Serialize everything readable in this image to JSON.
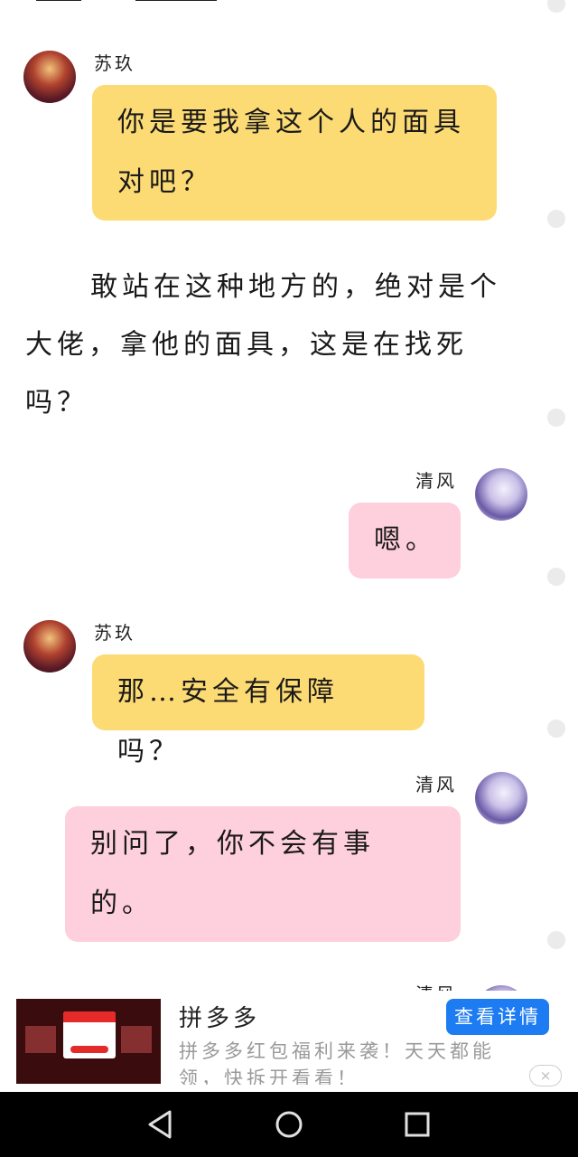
{
  "colors": {
    "yellow_bubble": "#fddb74",
    "pink_bubble": "#fecfdc",
    "ad_button": "#1d7cf2",
    "nav_bar": "#000000"
  },
  "chat": {
    "messages": [
      {
        "sender": "苏玖",
        "side": "left",
        "color": "yellow",
        "lines": [
          "你是要我拿这个人的面具",
          "对吧？"
        ]
      },
      {
        "type": "narration",
        "text": "敢站在这种地方的，绝对是个大佬，拿他的面具，这是在找死吗？"
      },
      {
        "sender": "清风",
        "side": "right",
        "color": "pink",
        "lines": [
          "嗯。"
        ]
      },
      {
        "sender": "苏玖",
        "side": "left",
        "color": "yellow",
        "lines": [
          "那…安全有保障吗？"
        ]
      },
      {
        "sender": "清风",
        "side": "right",
        "color": "pink",
        "lines": [
          "别问了，你不会有事",
          "的。"
        ]
      },
      {
        "sender": "清风",
        "side": "right",
        "partial": true
      }
    ]
  },
  "ad": {
    "title": "拼多多",
    "description": "拼多多红包福利来袭！天天都能领，快拆开看看！",
    "button_label": "查看详情",
    "close_icon": "×"
  },
  "navbar": {
    "icons": [
      "back-triangle-icon",
      "home-circle-icon",
      "recents-square-icon"
    ]
  }
}
